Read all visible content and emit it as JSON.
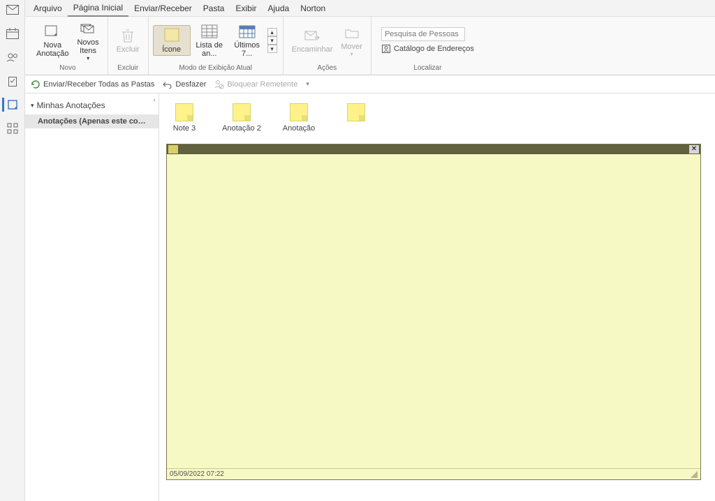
{
  "menu": {
    "items": [
      "Arquivo",
      "Página Inicial",
      "Enviar/Receber",
      "Pasta",
      "Exibir",
      "Ajuda",
      "Norton"
    ],
    "active_index": 1
  },
  "ribbon": {
    "groups": {
      "novo": {
        "label": "Novo",
        "nova_anotacao": "Nova\nAnotação",
        "novos_itens": "Novos\nItens"
      },
      "excluir": {
        "label": "Excluir",
        "btn": "Excluir"
      },
      "modo": {
        "label": "Modo de Exibição Atual",
        "icone": "Ícone",
        "lista": "Lista de an...",
        "ultimos": "Últimos 7..."
      },
      "acoes": {
        "label": "Ações",
        "encaminhar": "Encaminhar",
        "mover": "Mover"
      },
      "localizar": {
        "label": "Localizar",
        "search_placeholder": "Pesquisa de Pessoas",
        "catalogo": "Catálogo de Endereços"
      }
    }
  },
  "qa": {
    "send_receive": "Enviar/Receber Todas as Pastas",
    "undo": "Desfazer",
    "block": "Bloquear Remetente"
  },
  "nav": {
    "header": "Minhas Anotações",
    "folder": "Anotações (Apenas este computa..."
  },
  "notes": [
    {
      "label": "Note 3"
    },
    {
      "label": "Anotação 2"
    },
    {
      "label": "Anotação"
    },
    {
      "label": ""
    }
  ],
  "sticky": {
    "body": "",
    "timestamp": "05/09/2022 07:22"
  }
}
